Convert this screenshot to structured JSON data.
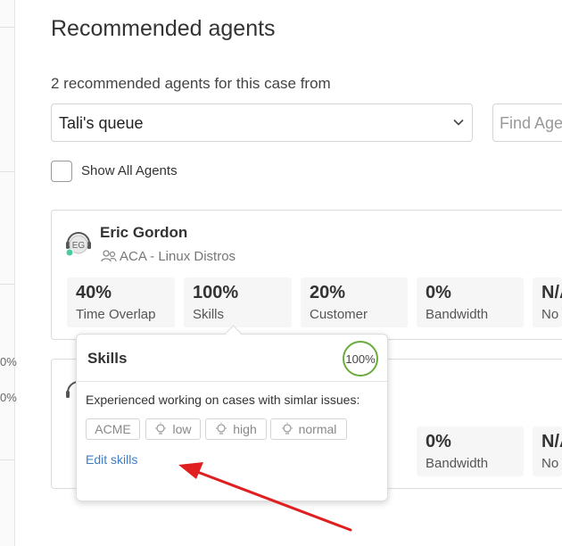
{
  "header": {
    "title": "Recommended agents",
    "subtitle": "2 recommended agents for this case from"
  },
  "left_strip": {
    "percent_1": "0%",
    "percent_2": "0%"
  },
  "filters": {
    "queue_value": "Tali's queue",
    "find_agent_placeholder": "Find Agent",
    "show_all_label": "Show All Agents",
    "show_all_checked": false
  },
  "agents": [
    {
      "initials": "EG",
      "name": "Eric Gordon",
      "team": "ACA - Linux Distros",
      "status_color": "#4cc9a0",
      "metrics": [
        {
          "value": "40%",
          "label": "Time Overlap"
        },
        {
          "value": "100%",
          "label": "Skills"
        },
        {
          "value": "20%",
          "label": "Customer"
        },
        {
          "value": "0%",
          "label": "Bandwidth"
        },
        {
          "value": "N/A",
          "label": "No"
        }
      ]
    },
    {
      "metrics": [
        {
          "value": "0%",
          "label": "Bandwidth"
        },
        {
          "value": "N/A",
          "label": "No"
        }
      ]
    }
  ],
  "skills_popover": {
    "title": "Skills",
    "score": "100%",
    "description": "Experienced working on cases with simlar issues:",
    "chips": [
      {
        "label": "ACME",
        "icon": ""
      },
      {
        "label": "low",
        "icon": "lightbulb-icon"
      },
      {
        "label": "high",
        "icon": "lightbulb-icon"
      },
      {
        "label": "normal",
        "icon": "lightbulb-icon"
      }
    ],
    "edit_link": "Edit skills"
  },
  "colors": {
    "accent_link": "#3d7cc9",
    "score_ring": "#6aab3c",
    "annotation_arrow": "#e02020"
  }
}
